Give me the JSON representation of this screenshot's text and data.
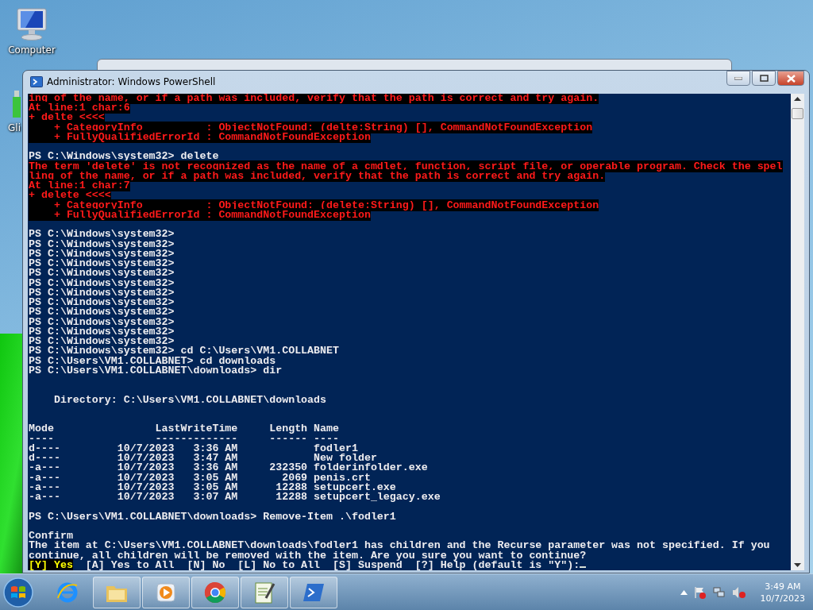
{
  "desktop_icons": [
    {
      "label": "Computer",
      "kind": "computer"
    },
    {
      "label": "Gli",
      "kind": "app"
    }
  ],
  "window": {
    "title": "Administrator: Windows PowerShell"
  },
  "console_lines": [
    {
      "kind": "error",
      "text": "ing of the name, or if a path was included, verify that the path is correct and try again."
    },
    {
      "kind": "error",
      "text": "At line:1 char:6"
    },
    {
      "kind": "error",
      "text": "+ delte <<<<"
    },
    {
      "kind": "error",
      "text": "    + CategoryInfo          : ObjectNotFound: (delte:String) [], CommandNotFoundException"
    },
    {
      "kind": "error",
      "text": "    + FullyQualifiedErrorId : CommandNotFoundException"
    },
    {
      "kind": "blank"
    },
    {
      "kind": "output",
      "text": "PS C:\\Windows\\system32> delete"
    },
    {
      "kind": "error",
      "text": "The term 'delete' is not recognized as the name of a cmdlet, function, script file, or operable program. Check the spel"
    },
    {
      "kind": "error",
      "text": "ling of the name, or if a path was included, verify that the path is correct and try again."
    },
    {
      "kind": "error",
      "text": "At line:1 char:7"
    },
    {
      "kind": "error",
      "text": "+ delete <<<<"
    },
    {
      "kind": "error",
      "text": "    + CategoryInfo          : ObjectNotFound: (delete:String) [], CommandNotFoundException"
    },
    {
      "kind": "error",
      "text": "    + FullyQualifiedErrorId : CommandNotFoundException"
    },
    {
      "kind": "blank"
    },
    {
      "kind": "output",
      "text": "PS C:\\Windows\\system32>"
    },
    {
      "kind": "output",
      "text": "PS C:\\Windows\\system32>"
    },
    {
      "kind": "output",
      "text": "PS C:\\Windows\\system32>"
    },
    {
      "kind": "output",
      "text": "PS C:\\Windows\\system32>"
    },
    {
      "kind": "output",
      "text": "PS C:\\Windows\\system32>"
    },
    {
      "kind": "output",
      "text": "PS C:\\Windows\\system32>"
    },
    {
      "kind": "output",
      "text": "PS C:\\Windows\\system32>"
    },
    {
      "kind": "output",
      "text": "PS C:\\Windows\\system32>"
    },
    {
      "kind": "output",
      "text": "PS C:\\Windows\\system32>"
    },
    {
      "kind": "output",
      "text": "PS C:\\Windows\\system32>"
    },
    {
      "kind": "output",
      "text": "PS C:\\Windows\\system32>"
    },
    {
      "kind": "output",
      "text": "PS C:\\Windows\\system32>"
    },
    {
      "kind": "output",
      "text": "PS C:\\Windows\\system32> cd C:\\Users\\VM1.COLLABNET"
    },
    {
      "kind": "output",
      "text": "PS C:\\Users\\VM1.COLLABNET> cd downloads"
    },
    {
      "kind": "output",
      "text": "PS C:\\Users\\VM1.COLLABNET\\downloads> dir"
    },
    {
      "kind": "blank"
    },
    {
      "kind": "blank"
    },
    {
      "kind": "output",
      "text": "    Directory: C:\\Users\\VM1.COLLABNET\\downloads"
    },
    {
      "kind": "blank"
    },
    {
      "kind": "blank"
    },
    {
      "kind": "output",
      "text": "Mode                LastWriteTime     Length Name"
    },
    {
      "kind": "output",
      "text": "----                -------------     ------ ----"
    },
    {
      "kind": "output",
      "text": "d----         10/7/2023   3:36 AM            fodler1"
    },
    {
      "kind": "output",
      "text": "d----         10/7/2023   3:47 AM            New folder"
    },
    {
      "kind": "output",
      "text": "-a---         10/7/2023   3:36 AM     232350 folderinfolder.exe"
    },
    {
      "kind": "output",
      "text": "-a---         10/7/2023   3:05 AM       2069 penis.crt"
    },
    {
      "kind": "output",
      "text": "-a---         10/7/2023   3:05 AM      12288 setupcert.exe"
    },
    {
      "kind": "output",
      "text": "-a---         10/7/2023   3:07 AM      12288 setupcert_legacy.exe"
    },
    {
      "kind": "blank"
    },
    {
      "kind": "output",
      "text": "PS C:\\Users\\VM1.COLLABNET\\downloads> Remove-Item .\\fodler1"
    },
    {
      "kind": "blank"
    },
    {
      "kind": "output",
      "text": "Confirm"
    },
    {
      "kind": "output",
      "text": "The item at C:\\Users\\VM1.COLLABNET\\downloads\\fodler1 has children and the Recurse parameter was not specified. If you"
    },
    {
      "kind": "output",
      "text": "continue, all children will be removed with the item. Are you sure you want to continue?"
    },
    {
      "kind": "choice",
      "parts": [
        {
          "kind": "highlight",
          "text": "[Y] Yes"
        },
        {
          "kind": "output",
          "text": "  [A] Yes to All  [N] No  [L] No to All  [S] Suspend  [?] Help (default is \"Y\"):"
        }
      ]
    }
  ],
  "taskbar": {
    "items": [
      {
        "kind": "ie",
        "running": false
      },
      {
        "kind": "explorer",
        "running": true
      },
      {
        "kind": "media",
        "running": true
      },
      {
        "kind": "chrome",
        "running": true
      },
      {
        "kind": "notepad",
        "running": true
      },
      {
        "kind": "powershell",
        "running": true
      }
    ],
    "clock_time": "3:49 AM",
    "clock_date": "10/7/2023"
  }
}
